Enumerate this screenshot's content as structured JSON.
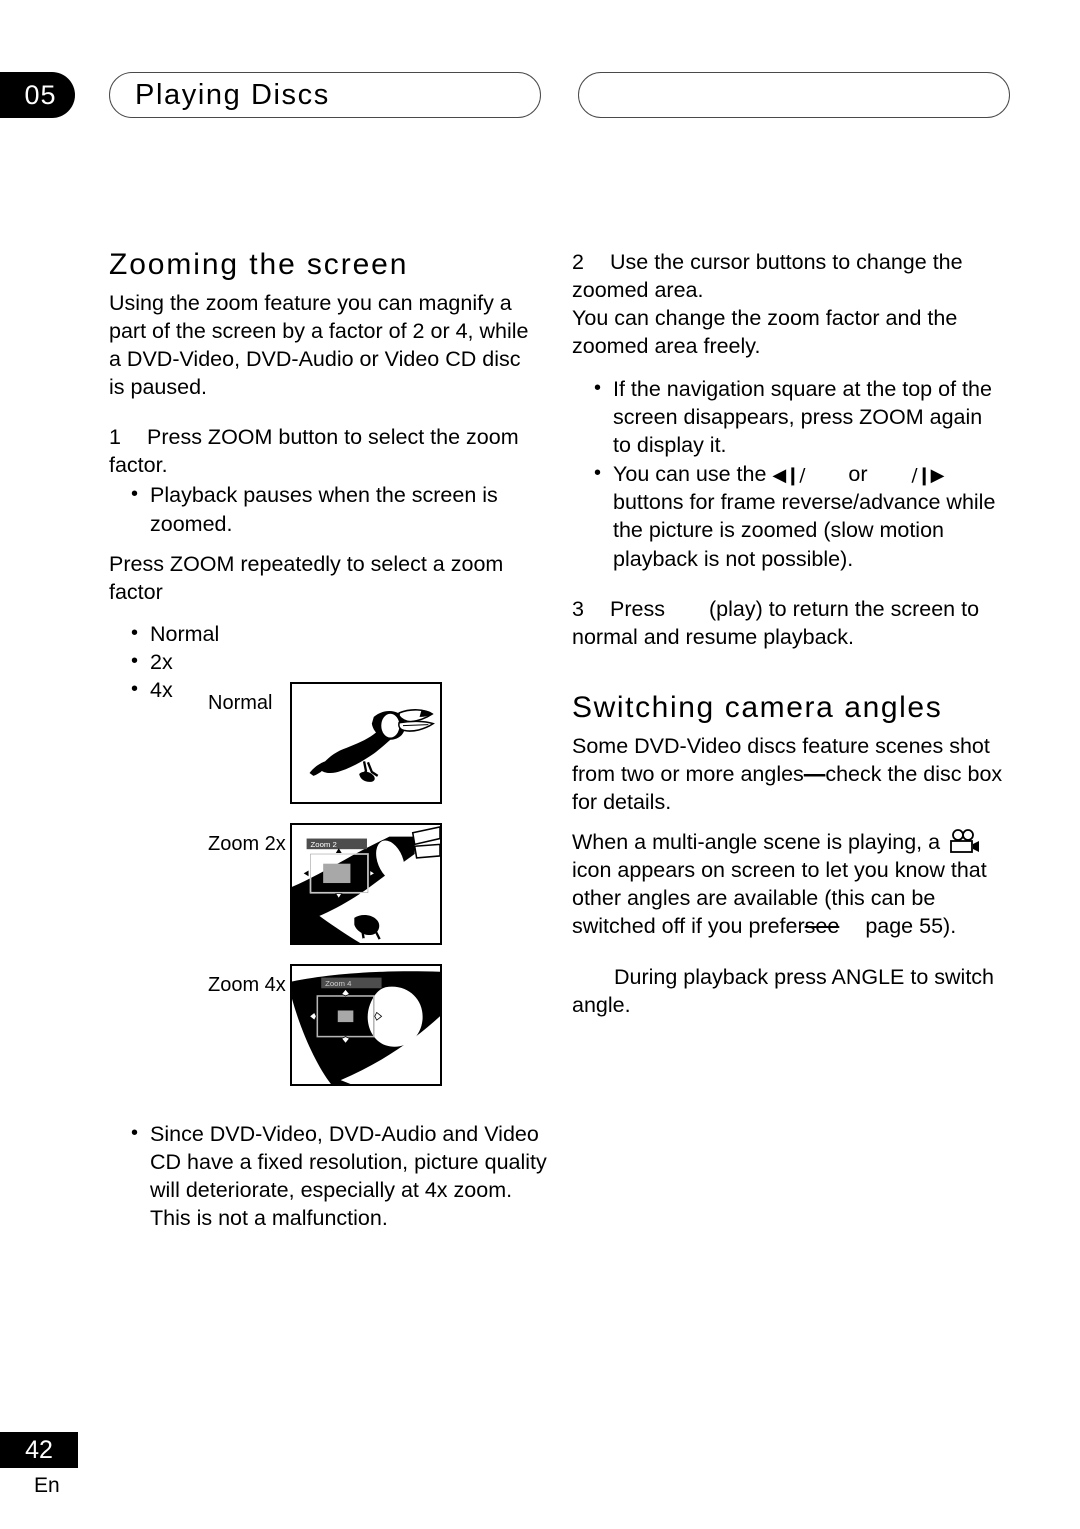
{
  "header": {
    "chapter_number": "05",
    "chapter_title": "Playing Discs",
    "right_pill_text": ""
  },
  "left_column": {
    "heading": "Zooming the screen",
    "intro": "Using the zoom feature you can magnify a part of the screen by a factor of 2 or 4, while a DVD-Video, DVD-Audio or Video CD disc is paused.",
    "step1_number": "1",
    "step1_text": "Press ZOOM button to  select the zoom factor.",
    "step1_bullet": "Playback pauses when the screen is zoomed.",
    "zoom_instruction": "Press ZOOM repeatedly to select a zoom factor",
    "factor_options": [
      "Normal",
      "2x",
      "4x"
    ],
    "bottom_bullet": "Since DVD-Video, DVD-Audio and Video CD have a fixed resolution, picture quality will deteriorate, especially at 4x zoom. This is not a malfunction."
  },
  "figures": [
    {
      "label": "Normal",
      "overlay_label": "",
      "illustration": "toucan-full"
    },
    {
      "label": "Zoom 2x",
      "overlay_label": "Zoom 2",
      "illustration": "toucan-zoom-2x"
    },
    {
      "label": "Zoom 4x",
      "overlay_label": "Zoom 4",
      "illustration": "toucan-zoom-4x"
    }
  ],
  "right_column": {
    "step2_number": "2",
    "step2_text": "Use the cursor buttons to change the zoomed area.",
    "step2_sub": "You can change the zoom factor and the zoomed area freely.",
    "step2_bullet1": "If the navigation square at the top of the screen disappears, press ZOOM again to display it.",
    "step2_bullet2_pre": "You can use the ",
    "step2_bullet2_glyph1": "◀❙/",
    "step2_bullet2_mid": "or",
    "step2_bullet2_glyph2": "/❙▶",
    "step2_bullet2_post": " buttons for frame reverse/advance while the picture is zoomed (slow motion playback is not possible).",
    "step3_number": "3",
    "step3_pre": "Press",
    "step3_post": "(play) to return the screen to normal and resume playback.",
    "heading2": "Switching camera angles",
    "para1_pre": "Some DVD-Video discs feature scenes shot from two or more angles",
    "para1_strike": "—",
    "para1_post": "check the disc box for details.",
    "para2_pre": "When a multi-angle scene is playing, a ",
    "para2_icon": "movie-camera-icon",
    "para2_mid": "icon appears on screen to let you know that other angles are available (this can be switched off if you prefer",
    "para2_strike": "see",
    "para2_page_ref": "page 55",
    "para2_post": ").",
    "para3": "During playback press ANGLE to switch angle."
  },
  "footer": {
    "page_number": "42",
    "language_code": "En"
  },
  "colors": {
    "ink": "#000000",
    "paper": "#ffffff",
    "overlay_bar": "#4d4d4d",
    "overlay_square": "#a8a8a8",
    "pill_border": "#4a4a4a"
  }
}
